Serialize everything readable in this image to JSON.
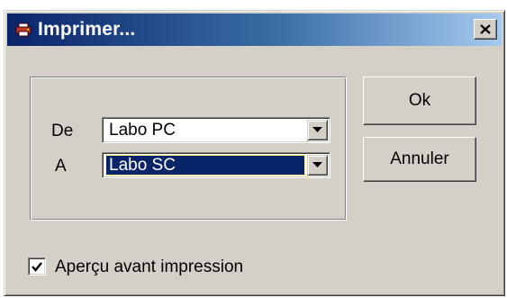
{
  "dialog": {
    "title": "Imprimer...",
    "close_label": "×",
    "icon": "printer-icon"
  },
  "form": {
    "de_label": "De",
    "a_label": "A",
    "de_value": "Labo PC",
    "a_value": "Labo SC"
  },
  "buttons": {
    "ok_label": "Ok",
    "cancel_label": "Annuler"
  },
  "preview": {
    "label": "Aperçu avant impression",
    "checked": true
  },
  "colors": {
    "title_bar": "#0a246a",
    "selection": "#0a246a",
    "face": "#d4d0c8"
  }
}
